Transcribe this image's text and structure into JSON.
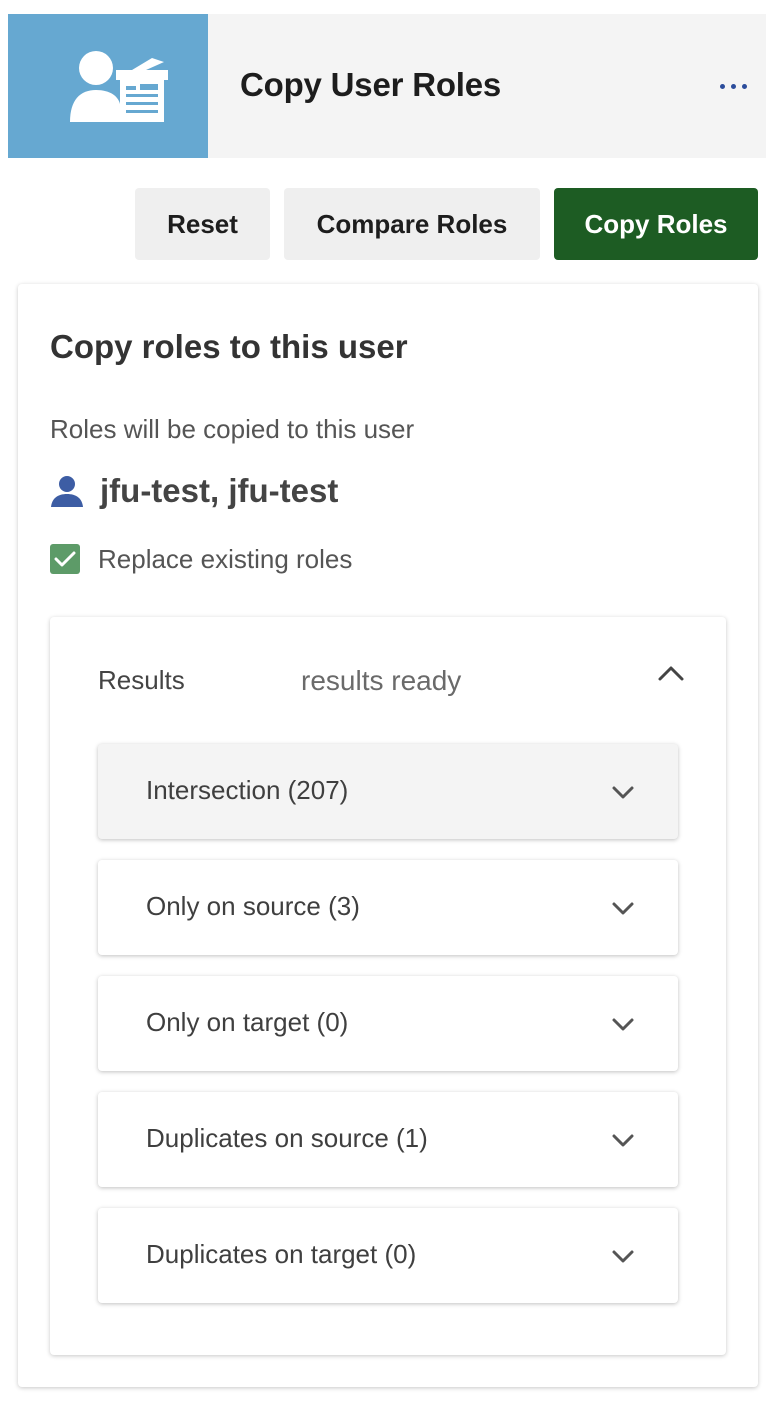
{
  "header": {
    "title": "Copy User Roles",
    "logo_icon": "user-copier-icon",
    "menu_icon": "more-dots-icon",
    "logo_color": "#66a8d1"
  },
  "toolbar": {
    "reset_label": "Reset",
    "compare_label": "Compare Roles",
    "copy_label": "Copy Roles",
    "copy_color": "#1d5c23"
  },
  "card": {
    "title": "Copy roles to this user",
    "subtitle": "Roles will be copied to this user",
    "user_name": "jfu-test, jfu-test",
    "user_icon": "person-icon",
    "replace_label": "Replace existing roles",
    "replace_checked": true
  },
  "results": {
    "label": "Results",
    "status": "results ready",
    "expanded": true,
    "panels": [
      {
        "label": "Intersection (207)",
        "active": true
      },
      {
        "label": "Only on source (3)",
        "active": false
      },
      {
        "label": "Only on target (0)",
        "active": false
      },
      {
        "label": "Duplicates on source (1)",
        "active": false
      },
      {
        "label": "Duplicates on target (0)",
        "active": false
      }
    ]
  }
}
